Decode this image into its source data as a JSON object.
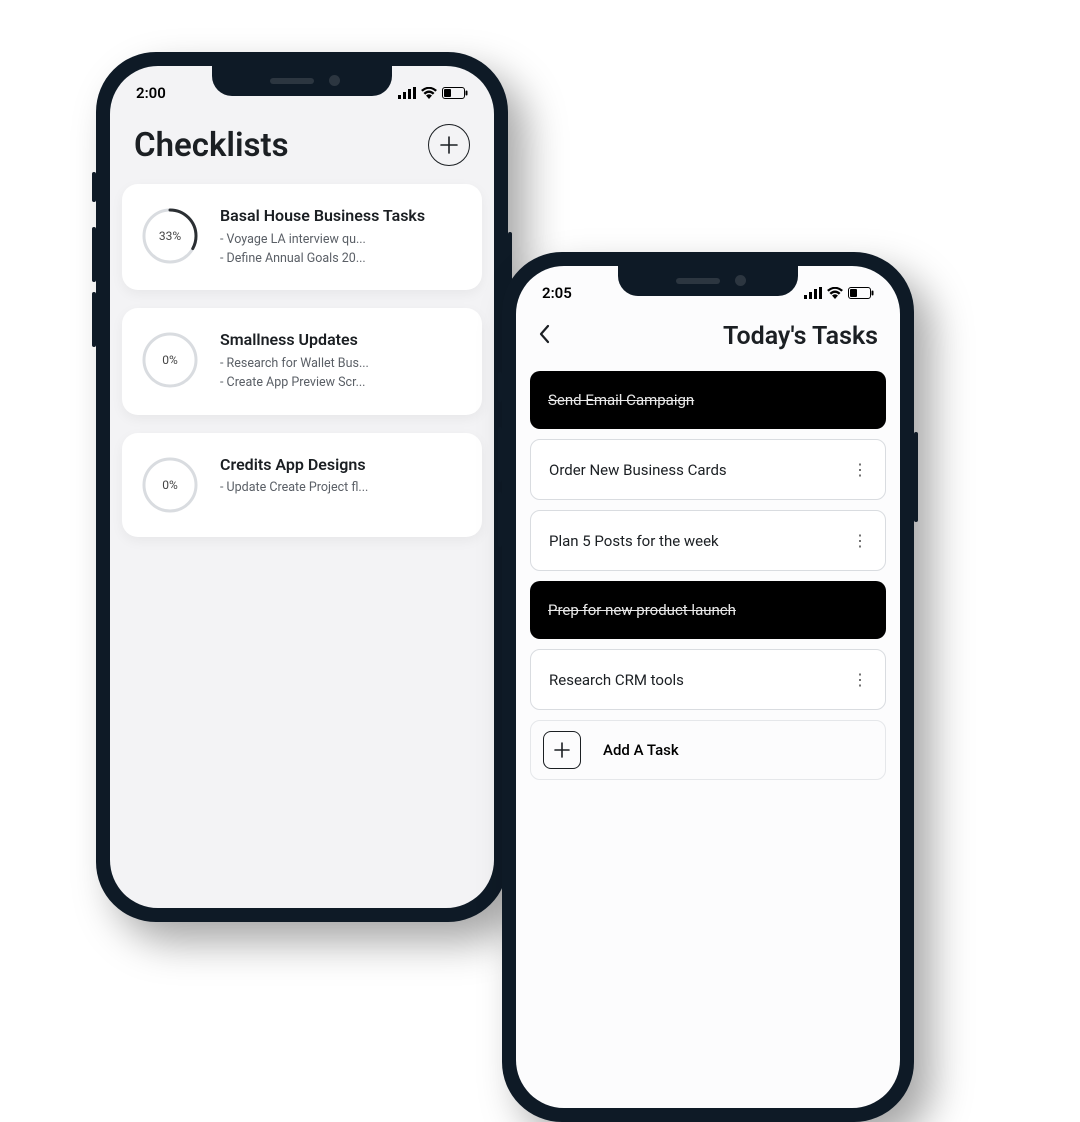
{
  "phone1": {
    "time": "2:00",
    "title": "Checklists",
    "cards": [
      {
        "pct": "33%",
        "pctVal": 33,
        "title": "Basal House Business Tasks",
        "sub1": "- Voyage LA interview qu...",
        "sub2": "- Define Annual Goals 20..."
      },
      {
        "pct": "0%",
        "pctVal": 0,
        "title": "Smallness Updates",
        "sub1": "- Research for Wallet Bus...",
        "sub2": "- Create App Preview Scr..."
      },
      {
        "pct": "0%",
        "pctVal": 0,
        "title": "Credits App Designs",
        "sub1": "- Update Create Project fl...",
        "sub2": ""
      }
    ]
  },
  "phone2": {
    "time": "2:05",
    "title": "Today's Tasks",
    "tasks": [
      {
        "label": "Send Email Campaign",
        "done": true
      },
      {
        "label": "Order New Business Cards",
        "done": false
      },
      {
        "label": "Plan 5 Posts for the week",
        "done": false
      },
      {
        "label": "Prep for new product launch",
        "done": true
      },
      {
        "label": "Research CRM tools",
        "done": false
      }
    ],
    "addTaskLabel": "Add A Task"
  }
}
